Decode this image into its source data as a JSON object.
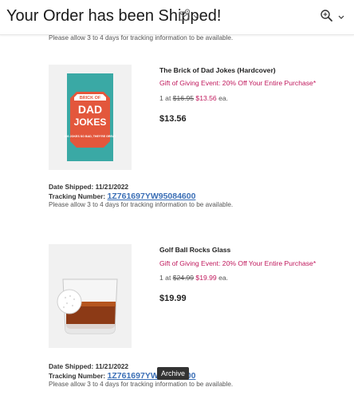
{
  "header": {
    "subject": "Your Order has been Shipped!",
    "envelope_icon": "envelope-gear-icon",
    "zoom_icon": "zoom-icon"
  },
  "top_note": "Please allow 3 to 4 days for tracking information to be available.",
  "items": [
    {
      "name": "The Brick of Dad Jokes (Hardcover)",
      "promo": "Gift of Giving Event: 20% Off Your Entire Purchase*",
      "qty_prefix": "1 at",
      "old_price": "$16.95",
      "new_price": "$13.56",
      "qty_suffix": "ea.",
      "total": "$13.56",
      "cover": {
        "label_top": "BRICK OF",
        "title_line1": "DAD",
        "title_line2": "JOKES",
        "subtitle": "400 JOKES SO BAD, THEY'RE GREAT"
      },
      "date_shipped": "Date Shipped: 11/21/2022",
      "tracking_label": "Tracking Number:",
      "tracking_number": "1Z761697YW95084600",
      "note": "Please allow 3 to 4 days for tracking information to be available."
    },
    {
      "name": "Golf Ball Rocks Glass",
      "promo": "Gift of Giving Event: 20% Off Your Entire Purchase*",
      "qty_prefix": "1 at",
      "old_price": "$24.99",
      "new_price": "$19.99",
      "qty_suffix": "ea.",
      "total": "$19.99",
      "date_shipped": "Date Shipped: 11/21/2022",
      "tracking_label": "Tracking Number:",
      "tracking_number": "1Z761697YW95084600",
      "note": "Please allow 3 to 4 days for tracking information to be available."
    }
  ],
  "tooltip": "Archive"
}
